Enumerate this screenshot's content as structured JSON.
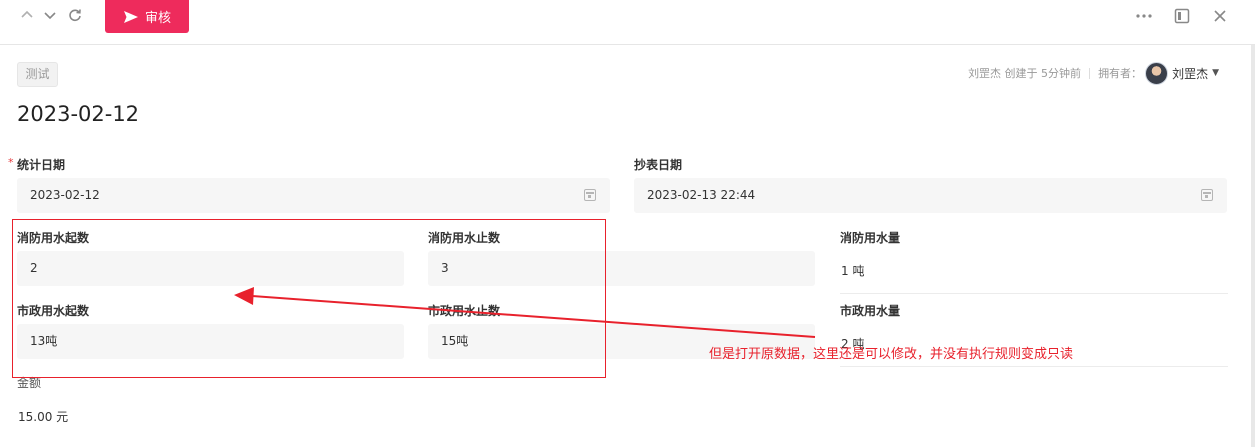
{
  "toolbar": {
    "approve_label": "审核",
    "approve_color": "#ee2b5c"
  },
  "record": {
    "tag": "测试",
    "title": "2023-02-12",
    "meta": {
      "creator_text": "刘罡杰 创建于 5分钟前",
      "owner_label": "拥有者：",
      "owner_name": "刘罡杰"
    }
  },
  "fields": {
    "stat_date": {
      "label": "统计日期",
      "required": "*",
      "value": "2023-02-12"
    },
    "meter_date": {
      "label": "抄表日期",
      "value": "2023-02-13 22:44"
    },
    "fire_start": {
      "label": "消防用水起数",
      "value": "2"
    },
    "fire_end": {
      "label": "消防用水止数",
      "value": "3"
    },
    "fire_amount": {
      "label": "消防用水量",
      "value": "1 吨"
    },
    "city_start": {
      "label": "市政用水起数",
      "value": "13吨"
    },
    "city_end": {
      "label": "市政用水止数",
      "value": "15吨"
    },
    "city_amount": {
      "label": "市政用水量",
      "value": "2 吨"
    },
    "amount": {
      "label": "金额",
      "value": "15.00 元"
    }
  },
  "annotation": {
    "text": "但是打开原数据，这里还是可以修改，并没有执行规则变成只读",
    "color": "#e8212c"
  },
  "icons": [
    "chevron-up-icon",
    "chevron-down-icon",
    "refresh-icon",
    "send-icon",
    "more-icon",
    "panel-icon",
    "close-icon",
    "calendar-icon",
    "caret-down-icon"
  ]
}
